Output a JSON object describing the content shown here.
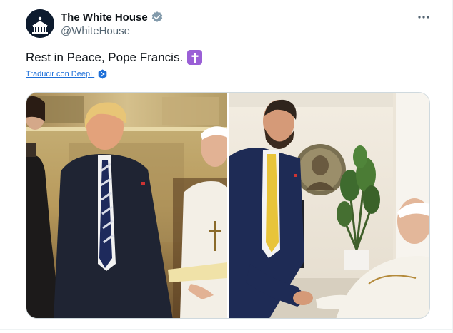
{
  "tweet": {
    "author_name": "The White House",
    "author_handle": "@WhiteHouse",
    "verified_badge_color": "#829aab",
    "text": "Rest in Peace, Pope Francis.",
    "emoji": "latin-cross-emoji",
    "translate_label": "Traducir con DeepL",
    "more_icon": "more-options-icon"
  },
  "media": {
    "photos": [
      {
        "description_icon": "photo-vatican-meeting"
      },
      {
        "description_icon": "photo-handshake"
      }
    ]
  },
  "colors": {
    "link": "#1d6fd8",
    "secondary_text": "#536471",
    "border": "#cfd9de"
  }
}
